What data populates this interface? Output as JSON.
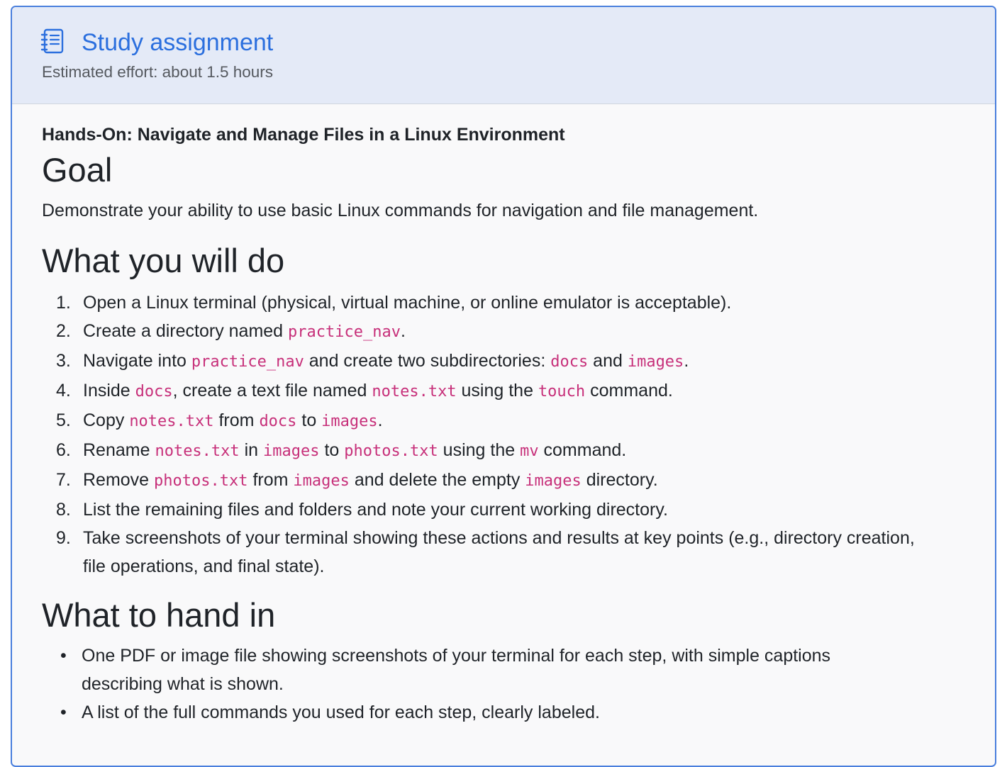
{
  "header": {
    "icon": "notebook-list-icon",
    "title": "Study assignment",
    "effort": "Estimated effort: about 1.5 hours"
  },
  "content": {
    "subtitle": "Hands-On: Navigate and Manage Files in a Linux Environment",
    "goal_heading": "Goal",
    "goal_text": "Demonstrate your ability to use basic Linux commands for navigation and file management.",
    "do_heading": "What you will do",
    "steps": [
      {
        "num": "1.",
        "parts": [
          {
            "t": "Open a Linux terminal (physical, virtual machine, or online emulator is acceptable)."
          }
        ]
      },
      {
        "num": "2.",
        "parts": [
          {
            "t": "Create a directory named "
          },
          {
            "c": "practice_nav"
          },
          {
            "t": "."
          }
        ]
      },
      {
        "num": "3.",
        "parts": [
          {
            "t": "Navigate into "
          },
          {
            "c": "practice_nav"
          },
          {
            "t": " and create two subdirectories: "
          },
          {
            "c": "docs"
          },
          {
            "t": " and "
          },
          {
            "c": "images"
          },
          {
            "t": "."
          }
        ]
      },
      {
        "num": "4.",
        "parts": [
          {
            "t": "Inside "
          },
          {
            "c": "docs"
          },
          {
            "t": ", create a text file named "
          },
          {
            "c": "notes.txt"
          },
          {
            "t": " using the "
          },
          {
            "c": "touch"
          },
          {
            "t": " command."
          }
        ]
      },
      {
        "num": "5.",
        "parts": [
          {
            "t": "Copy "
          },
          {
            "c": "notes.txt"
          },
          {
            "t": " from "
          },
          {
            "c": "docs"
          },
          {
            "t": " to "
          },
          {
            "c": "images"
          },
          {
            "t": "."
          }
        ]
      },
      {
        "num": "6.",
        "parts": [
          {
            "t": "Rename "
          },
          {
            "c": "notes.txt"
          },
          {
            "t": " in "
          },
          {
            "c": "images"
          },
          {
            "t": " to "
          },
          {
            "c": "photos.txt"
          },
          {
            "t": " using the "
          },
          {
            "c": "mv"
          },
          {
            "t": " command."
          }
        ]
      },
      {
        "num": "7.",
        "parts": [
          {
            "t": "Remove "
          },
          {
            "c": "photos.txt"
          },
          {
            "t": " from "
          },
          {
            "c": "images"
          },
          {
            "t": " and delete the empty "
          },
          {
            "c": "images"
          },
          {
            "t": " directory."
          }
        ]
      },
      {
        "num": "8.",
        "parts": [
          {
            "t": "List the remaining files and folders and note your current working directory."
          }
        ]
      },
      {
        "num": "9.",
        "parts": [
          {
            "t": "Take screenshots of your terminal showing these actions and results at key points (e.g., directory creation, file operations, and final state)."
          }
        ]
      }
    ],
    "hand_heading": "What to hand in",
    "deliverables": [
      "One PDF or image file showing screenshots of your terminal for each step, with simple captions describing what is shown.",
      "A list of the full commands you used for each step, clearly labeled."
    ]
  }
}
